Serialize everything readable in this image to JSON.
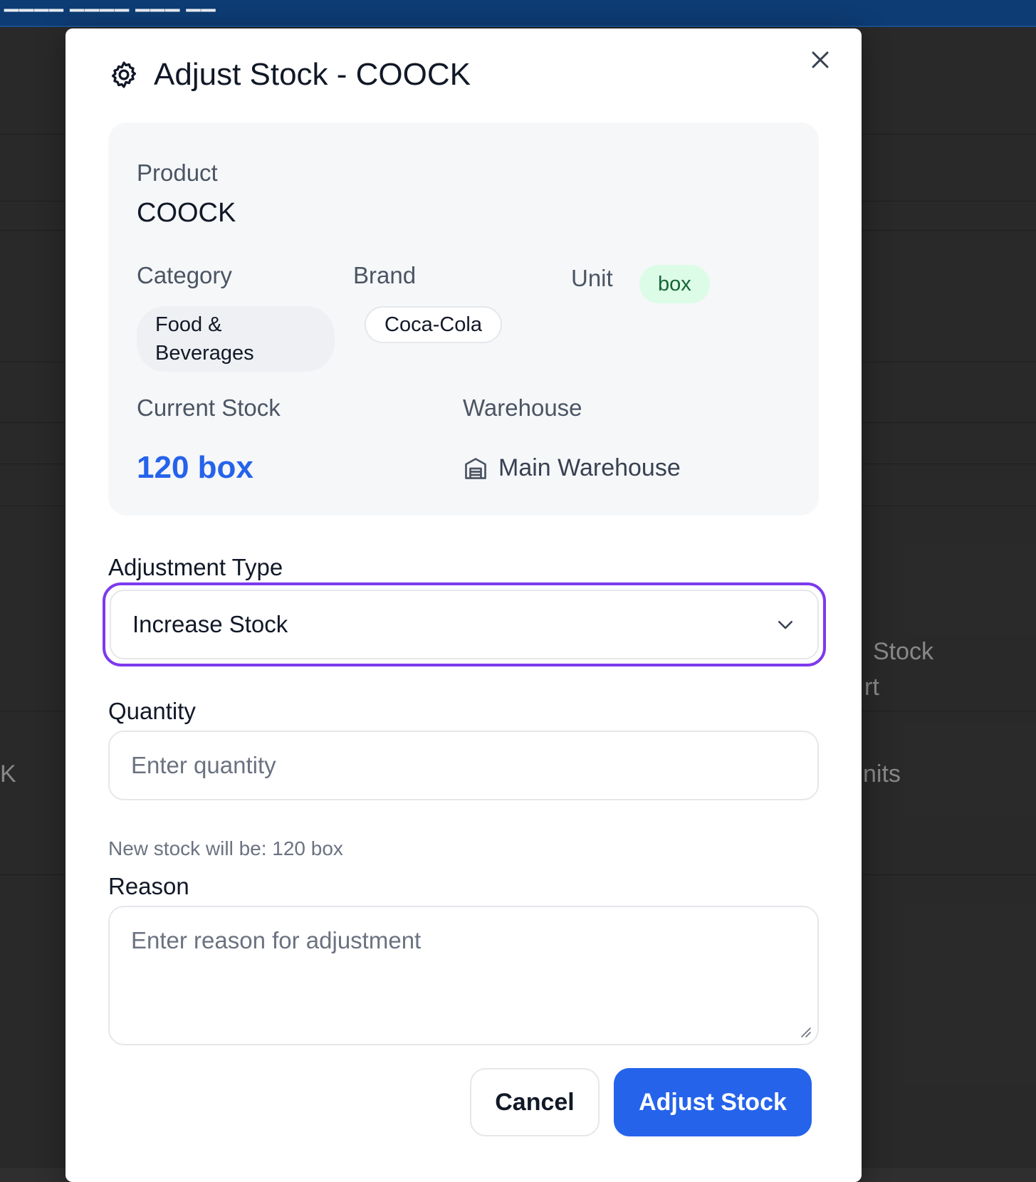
{
  "background": {
    "header_fragment": "▁▁▁▁ ▁▁▁▁ ▁▁▁ ▁▁",
    "row_text_1": "K",
    "row_text_2": "Stock",
    "row_text_3": "rt",
    "row_text_4": "nits"
  },
  "modal": {
    "title": "Adjust Stock - COOCK",
    "title_icon": "gear-icon",
    "close_icon": "close-icon",
    "product_label": "Product",
    "product_value": "COOCK",
    "category_label": "Category",
    "category_value": "Food & Beverages",
    "brand_label": "Brand",
    "brand_value": "Coca-Cola",
    "unit_label": "Unit",
    "unit_value": "box",
    "current_stock_label": "Current Stock",
    "current_stock_value": "120 box",
    "warehouse_label": "Warehouse",
    "warehouse_icon": "warehouse-icon",
    "warehouse_value": "Main Warehouse"
  },
  "form": {
    "adjustment_type_label": "Adjustment Type",
    "adjustment_type_value": "Increase Stock",
    "quantity_label": "Quantity",
    "quantity_placeholder": "Enter quantity",
    "helper_text": "New stock will be: 120 box",
    "reason_label": "Reason",
    "reason_placeholder": "Enter reason for adjustment"
  },
  "actions": {
    "cancel_label": "Cancel",
    "submit_label": "Adjust Stock"
  },
  "colors": {
    "primary": "#2563eb",
    "focus_ring": "#7c3aed",
    "unit_badge_bg": "#dcfce7",
    "unit_badge_text": "#166534",
    "header": "#0d3b73"
  }
}
